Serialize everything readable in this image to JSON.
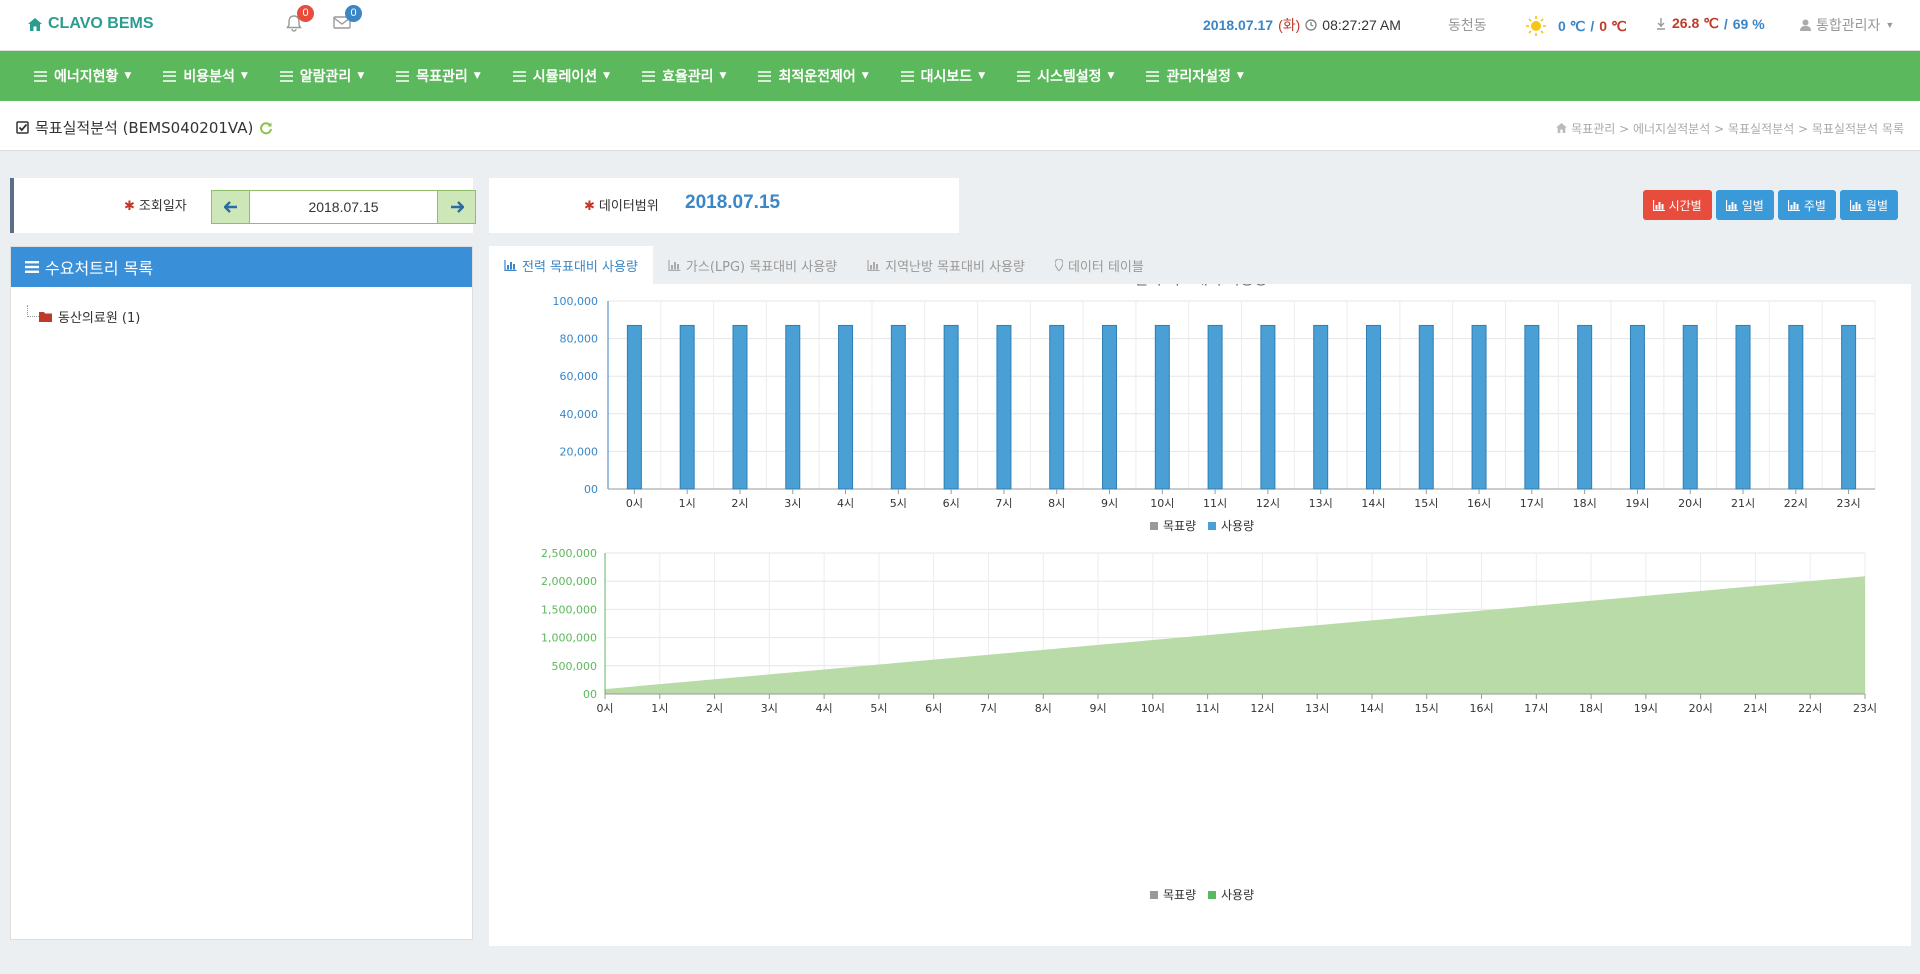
{
  "brand": {
    "name": "CLAVO BEMS",
    "icon": "home-icon"
  },
  "notifications": {
    "alerts_count": "0",
    "messages_count": "0"
  },
  "header_status": {
    "date": "2018.07.17",
    "weekday": "(화)",
    "time": "08:27:27 AM",
    "location": "동천동",
    "outdoor_temp": "0 ℃",
    "outdoor_temp_sep": "/",
    "outdoor_temp2": "0 ℃",
    "indoor_temp": "26.8 ℃",
    "indoor_sep": "/",
    "indoor_humidity": "69 %",
    "user": "통합관리자"
  },
  "nav": {
    "items": [
      "에너지현황",
      "비용분석",
      "알람관리",
      "목표관리",
      "시뮬레이션",
      "효율관리",
      "최적운전제어",
      "대시보드",
      "시스템설정",
      "관리자설정"
    ]
  },
  "page": {
    "title": "목표실적분석 (BEMS040201VA)",
    "breadcrumb": "목표관리 > 에너지실적분석 > 목표실적분석 > 목표실적분석 목록"
  },
  "filter": {
    "date_label": "조회일자",
    "date_value": "2018.07.15",
    "range_label": "데이터범위",
    "range_value": "2018.07.15",
    "period_buttons": [
      "시간별",
      "일별",
      "주별",
      "월별"
    ]
  },
  "tree": {
    "title": "수요처트리 목록",
    "items": [
      "동산의료원 (1)"
    ]
  },
  "tabs": [
    "전력 목표대비 사용량",
    "가스(LPG) 목표대비 사용량",
    "지역난방 목표대비 사용량",
    "데이터 테이블"
  ],
  "colors": {
    "accent_green": "#5cb85c",
    "bar_blue": "#4a9fd4",
    "area_green": "#b8dba8",
    "danger_red": "#e74c3c",
    "primary_blue": "#3a9ad9"
  },
  "chart_data": [
    {
      "type": "bar",
      "title": "전력 목표대비 사용량",
      "categories": [
        "0시",
        "1시",
        "2시",
        "3시",
        "4시",
        "5시",
        "6시",
        "7시",
        "8시",
        "9시",
        "10시",
        "11시",
        "12시",
        "13시",
        "14시",
        "15시",
        "16시",
        "17시",
        "18시",
        "19시",
        "20시",
        "21시",
        "22시",
        "23시"
      ],
      "series": [
        {
          "name": "목표량",
          "values": [
            0,
            0,
            0,
            0,
            0,
            0,
            0,
            0,
            0,
            0,
            0,
            0,
            0,
            0,
            0,
            0,
            0,
            0,
            0,
            0,
            0,
            0,
            0,
            0
          ],
          "color": "#999999"
        },
        {
          "name": "사용량",
          "values": [
            87000,
            87000,
            87000,
            87000,
            87000,
            87000,
            87000,
            87000,
            87000,
            87000,
            87000,
            87000,
            87000,
            87000,
            87000,
            87000,
            87000,
            87000,
            87000,
            87000,
            87000,
            87000,
            87000,
            87000
          ],
          "color": "#4a9fd4"
        }
      ],
      "yticks": [
        "100,000",
        "80,000",
        "60,000",
        "40,000",
        "20,000",
        "00"
      ],
      "ylim": [
        0,
        100000
      ],
      "grid": true,
      "legend": "bottom-center"
    },
    {
      "type": "area",
      "categories": [
        "0시",
        "1시",
        "2시",
        "3시",
        "4시",
        "5시",
        "6시",
        "7시",
        "8시",
        "9시",
        "10시",
        "11시",
        "12시",
        "13시",
        "14시",
        "15시",
        "16시",
        "17시",
        "18시",
        "19시",
        "20시",
        "21시",
        "22시",
        "23시"
      ],
      "series": [
        {
          "name": "목표량",
          "values": [
            0,
            0,
            0,
            0,
            0,
            0,
            0,
            0,
            0,
            0,
            0,
            0,
            0,
            0,
            0,
            0,
            0,
            0,
            0,
            0,
            0,
            0,
            0,
            0
          ],
          "color": "#999999"
        },
        {
          "name": "사용량",
          "values": [
            87000,
            174000,
            261000,
            348000,
            435000,
            522000,
            609000,
            696000,
            783000,
            870000,
            957000,
            1044000,
            1131000,
            1218000,
            1305000,
            1392000,
            1479000,
            1566000,
            1653000,
            1740000,
            1827000,
            1914000,
            2001000,
            2088000
          ],
          "color": "#5cb85c"
        }
      ],
      "yticks": [
        "2,500,000",
        "2,000,000",
        "1,500,000",
        "1,000,000",
        "500,000",
        "00"
      ],
      "ylim": [
        0,
        2500000
      ],
      "grid": true,
      "legend": "bottom-center"
    }
  ]
}
